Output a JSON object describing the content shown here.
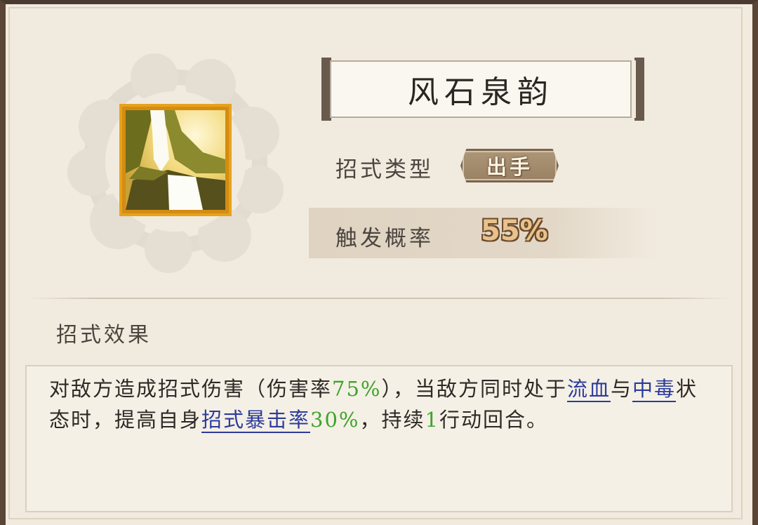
{
  "skill": {
    "name": "风石泉韵",
    "icon": "waterfall-icon"
  },
  "type_label": "招式类型",
  "type_value": "出手",
  "rate_label": "触发概率",
  "rate_value": "55%",
  "effect_label": "招式效果",
  "effect": {
    "p1": "对敌方造成招式伤害（伤害率",
    "v1": "75%",
    "p2": "），当敌方同时处于",
    "k1": "流血",
    "p3": "与",
    "k2": "中毒",
    "p4": "状态时，提高自身",
    "k3": "招式暴击率",
    "v2": "30%",
    "p5": "，持续",
    "v3": "1",
    "p6": "行动回合。"
  },
  "colors": {
    "highlight_value": "#3da42a",
    "keyword": "#2c3b9a",
    "icon_frame": "#e7a21c"
  }
}
